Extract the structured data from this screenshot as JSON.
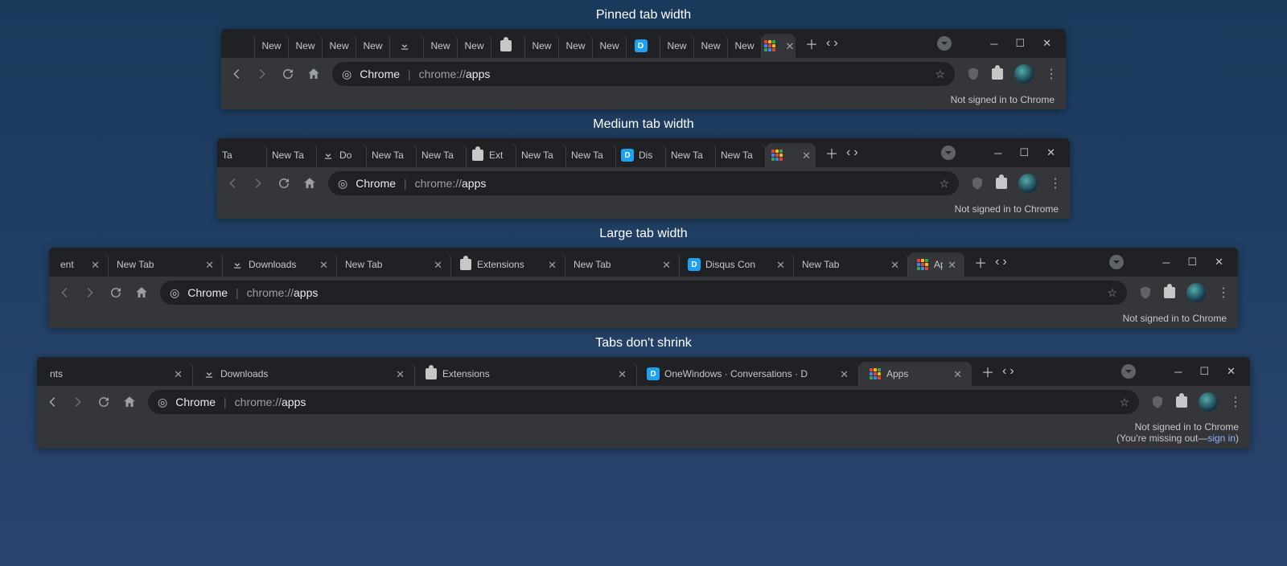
{
  "captions": {
    "pinned": "Pinned tab width",
    "medium": "Medium tab width",
    "large": "Large tab width",
    "noshrink": "Tabs don't shrink"
  },
  "omnibox": {
    "site": "Chrome",
    "protocol": "chrome://",
    "path": "apps"
  },
  "status": {
    "not_signed": "Not signed in to Chrome",
    "missing_prefix": "(You're missing out—",
    "sign_in": "sign in",
    "missing_suffix": ")"
  },
  "b1": {
    "tabs": [
      {
        "label": ""
      },
      {
        "label": "New"
      },
      {
        "label": "New"
      },
      {
        "label": "New"
      },
      {
        "label": "New"
      },
      {
        "label": "",
        "icon": "download"
      },
      {
        "label": "New"
      },
      {
        "label": "New"
      },
      {
        "label": "",
        "icon": "puzzle"
      },
      {
        "label": "New"
      },
      {
        "label": "New"
      },
      {
        "label": "New"
      },
      {
        "label": "",
        "icon": "disqus"
      },
      {
        "label": "New"
      },
      {
        "label": "New"
      },
      {
        "label": "New"
      },
      {
        "label": "",
        "icon": "apps",
        "active": true
      }
    ]
  },
  "b2": {
    "tabs": [
      {
        "label": "Ta"
      },
      {
        "label": "New Ta"
      },
      {
        "label": "Do",
        "icon": "download"
      },
      {
        "label": "New Ta"
      },
      {
        "label": "New Ta"
      },
      {
        "label": "Ext",
        "icon": "puzzle"
      },
      {
        "label": "New Ta"
      },
      {
        "label": "New Ta"
      },
      {
        "label": "Dis",
        "icon": "disqus"
      },
      {
        "label": "New Ta"
      },
      {
        "label": "New Ta"
      },
      {
        "label": "",
        "icon": "apps",
        "active": true
      }
    ]
  },
  "b3": {
    "tabs": [
      {
        "label": "ent",
        "close": true,
        "first": true
      },
      {
        "label": "New Tab",
        "close": true
      },
      {
        "label": "Downloads",
        "icon": "download",
        "close": true
      },
      {
        "label": "New Tab",
        "close": true
      },
      {
        "label": "Extensions",
        "icon": "puzzle",
        "close": true
      },
      {
        "label": "New Tab",
        "close": true
      },
      {
        "label": "Disqus Con",
        "icon": "disqus",
        "close": true
      },
      {
        "label": "New Tab",
        "close": true
      },
      {
        "label": "App",
        "icon": "apps",
        "active": true
      }
    ]
  },
  "b4": {
    "tabs": [
      {
        "label": "nts",
        "close": true,
        "first": true
      },
      {
        "label": "Downloads",
        "icon": "download",
        "close": true
      },
      {
        "label": "Extensions",
        "icon": "puzzle",
        "close": true
      },
      {
        "label": "OneWindows · Conversations · D",
        "icon": "disqus",
        "close": true
      },
      {
        "label": "Apps",
        "icon": "apps",
        "active": true
      }
    ]
  }
}
